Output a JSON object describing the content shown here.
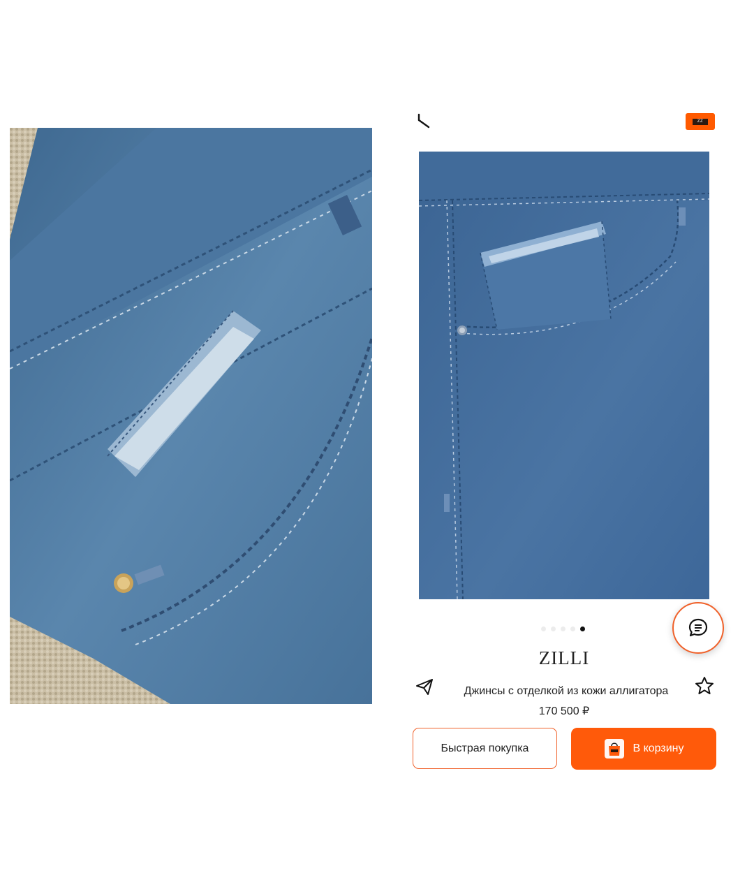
{
  "header": {
    "back_icon": "back-arrow-icon",
    "brand_badge_text": "ZZ"
  },
  "gallery": {
    "slide_count": 5,
    "active_index": 4
  },
  "product": {
    "brand": "ZILLI",
    "title": "Джинсы с отделкой из кожи аллигатора",
    "price": "170 500 ₽"
  },
  "actions": {
    "quick_buy_label": "Быстрая покупка",
    "cart_label": "В корзину"
  },
  "icons": {
    "share": "paper-plane-icon",
    "favorite": "star-icon",
    "chat": "chat-bubble-icon",
    "bag": "shopping-bag-icon"
  },
  "colors": {
    "accent": "#ff5a0a",
    "accent_border": "#f0612a",
    "text": "#222222"
  }
}
